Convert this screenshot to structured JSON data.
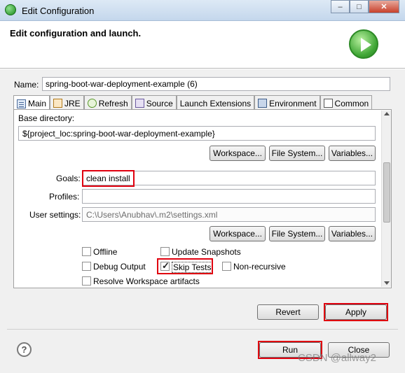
{
  "window": {
    "title": "Edit Configuration"
  },
  "header": {
    "title": "Edit configuration and launch."
  },
  "name": {
    "label": "Name:",
    "value": "spring-boot-war-deployment-example (6)"
  },
  "tabs": [
    {
      "label": "Main",
      "icon": "doc-icon"
    },
    {
      "label": "JRE",
      "icon": "jre-icon"
    },
    {
      "label": "Refresh",
      "icon": "refresh-icon"
    },
    {
      "label": "Source",
      "icon": "source-icon"
    },
    {
      "label": "Launch Extensions",
      "icon": ""
    },
    {
      "label": "Environment",
      "icon": "environment-icon"
    },
    {
      "label": "Common",
      "icon": "common-icon"
    }
  ],
  "main": {
    "base_dir_label": "Base directory:",
    "base_dir_value": "${project_loc:spring-boot-war-deployment-example}",
    "workspace_btn": "Workspace...",
    "filesystem_btn": "File System...",
    "variables_btn": "Variables...",
    "goals_label": "Goals:",
    "goals_value": "clean install",
    "profiles_label": "Profiles:",
    "profiles_value": "",
    "settings_label": "User settings:",
    "settings_value": "C:\\Users\\Anubhav\\.m2\\settings.xml",
    "options": {
      "offline": {
        "label": "Offline",
        "checked": false
      },
      "update_snapshots": {
        "label": "Update Snapshots",
        "checked": false
      },
      "debug_output": {
        "label": "Debug Output",
        "checked": false
      },
      "skip_tests": {
        "label": "Skip Tests",
        "checked": true
      },
      "non_recursive": {
        "label": "Non-recursive",
        "checked": false
      },
      "resolve_workspace": {
        "label": "Resolve Workspace artifacts",
        "checked": false
      }
    }
  },
  "buttons": {
    "revert": "Revert",
    "apply": "Apply",
    "run": "Run",
    "close": "Close",
    "help": "?"
  },
  "watermark": "CSDN @allway2",
  "colors": {
    "highlight": "#e0000f",
    "accent_run": "#3fa635"
  }
}
